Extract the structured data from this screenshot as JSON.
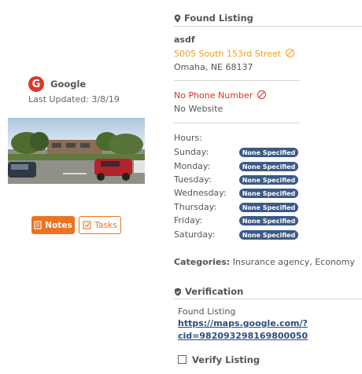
{
  "left": {
    "source_name": "Google",
    "source_logo_letter": "G",
    "last_updated": "Last Updated: 3/8/19",
    "buttons": {
      "notes_label": "Notes",
      "tasks_label": "Tasks"
    }
  },
  "found_listing": {
    "title": "Found Listing",
    "business_name": "asdf",
    "street": "5005 South 153rd Street",
    "city_state_zip": "Omaha, NE 68137",
    "phone": "No Phone Number",
    "website": "No Website",
    "hours_label": "Hours:",
    "hours": [
      {
        "day": "Sunday:",
        "value": "None Specified"
      },
      {
        "day": "Monday:",
        "value": "None Specified"
      },
      {
        "day": "Tuesday:",
        "value": "None Specified"
      },
      {
        "day": "Wednesday:",
        "value": "None Specified"
      },
      {
        "day": "Thursday:",
        "value": "None Specified"
      },
      {
        "day": "Friday:",
        "value": "None Specified"
      },
      {
        "day": "Saturday:",
        "value": "None Specified"
      }
    ],
    "categories_label": "Categories:",
    "categories_value": "Insurance agency, Economy"
  },
  "verification": {
    "title": "Verification",
    "found_label": "Found Listing",
    "url_line1": "https://maps.google.com/?",
    "url_line2": "cid=982093298169800050",
    "verify_label": "Verify Listing"
  },
  "colors": {
    "accent_orange": "#ec7320",
    "address_orange": "#f0a020",
    "error_red": "#d9312b",
    "pill_blue": "#3b5a86",
    "google_red": "#d93a2b"
  },
  "icons": {
    "found_listing": "map-marker-icon",
    "verification": "shield-check-icon",
    "notes": "note-icon",
    "tasks": "checkbox-icon",
    "invalid": "ban-icon"
  }
}
